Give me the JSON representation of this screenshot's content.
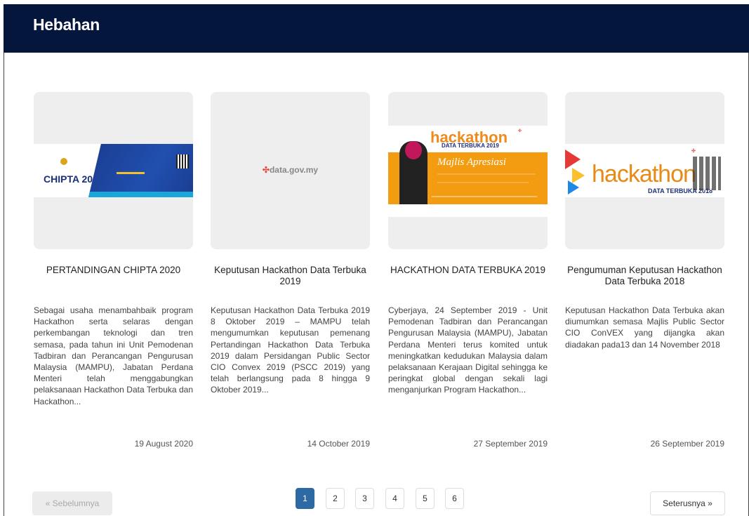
{
  "header": {
    "title": "Hebahan"
  },
  "cards": [
    {
      "image_caption": "CHIPTA 2020",
      "title": "PERTANDINGAN CHIPTA 2020",
      "description": "Sebagai usaha menambahbaik program Hackathon serta selaras dengan perkembangan teknologi dan tren semasa, pada tahun ini Unit Pemodenan Tadbiran dan Perancangan Pengurusan Malaysia (MAMPU), Jabatan Perdana Menteri telah menggabungkan pelaksanaan Hackathon Data Terbuka dan Hackathon...",
      "date": "19 August 2020"
    },
    {
      "image_caption": "data.gov.my",
      "title": "Keputusan Hackathon Data Terbuka 2019",
      "description": "Keputusan Hackathon Data Terbuka 2019 8 Oktober 2019 – MAMPU telah mengumumkan keputusan pemenang Pertandingan Hackathon Data Terbuka 2019 dalam Persidangan Public Sector CIO Convex 2019 (PSCC 2019) yang telah berlangsung pada 8 hingga 9 Oktober 2019...",
      "date": "14 October 2019"
    },
    {
      "image_caption": "hackathon",
      "image_caption2": "DATA TERBUKA 2019",
      "image_caption3": "Majlis Apresiasi",
      "title": "HACKATHON DATA TERBUKA 2019",
      "description": "Cyberjaya, 24 September 2019 - Unit Pemodenan Tadbiran dan Perancangan Pengurusan Malaysia (MAMPU), Jabatan Perdana Menteri terus komited untuk meningkatkan kedudukan Malaysia dalam pelaksanaan Kerajaan Digital sehingga ke peringkat global dengan sekali lagi menganjurkan Program Hackathon...",
      "date": "27 September 2019"
    },
    {
      "image_caption": "hackathon",
      "image_caption2": "DATA TERBUKA 2018",
      "title": "Pengumuman Keputusan Hackathon Data Terbuka 2018",
      "description": "Keputusan Hackathon Data Terbuka akan diumumkan semasa Majlis Public Sector CIO ConVEX yang dijangka akan diadakan pada13 dan 14 November 2018",
      "date": "26 September 2019"
    }
  ],
  "pagination": {
    "prev_label": "« Sebelumnya",
    "next_label": "Seterusnya »",
    "pages": [
      "1",
      "2",
      "3",
      "4",
      "5",
      "6"
    ],
    "active_page": "1"
  },
  "colors": {
    "header_bg": "#04163c",
    "active_page": "#2d6aa3"
  }
}
